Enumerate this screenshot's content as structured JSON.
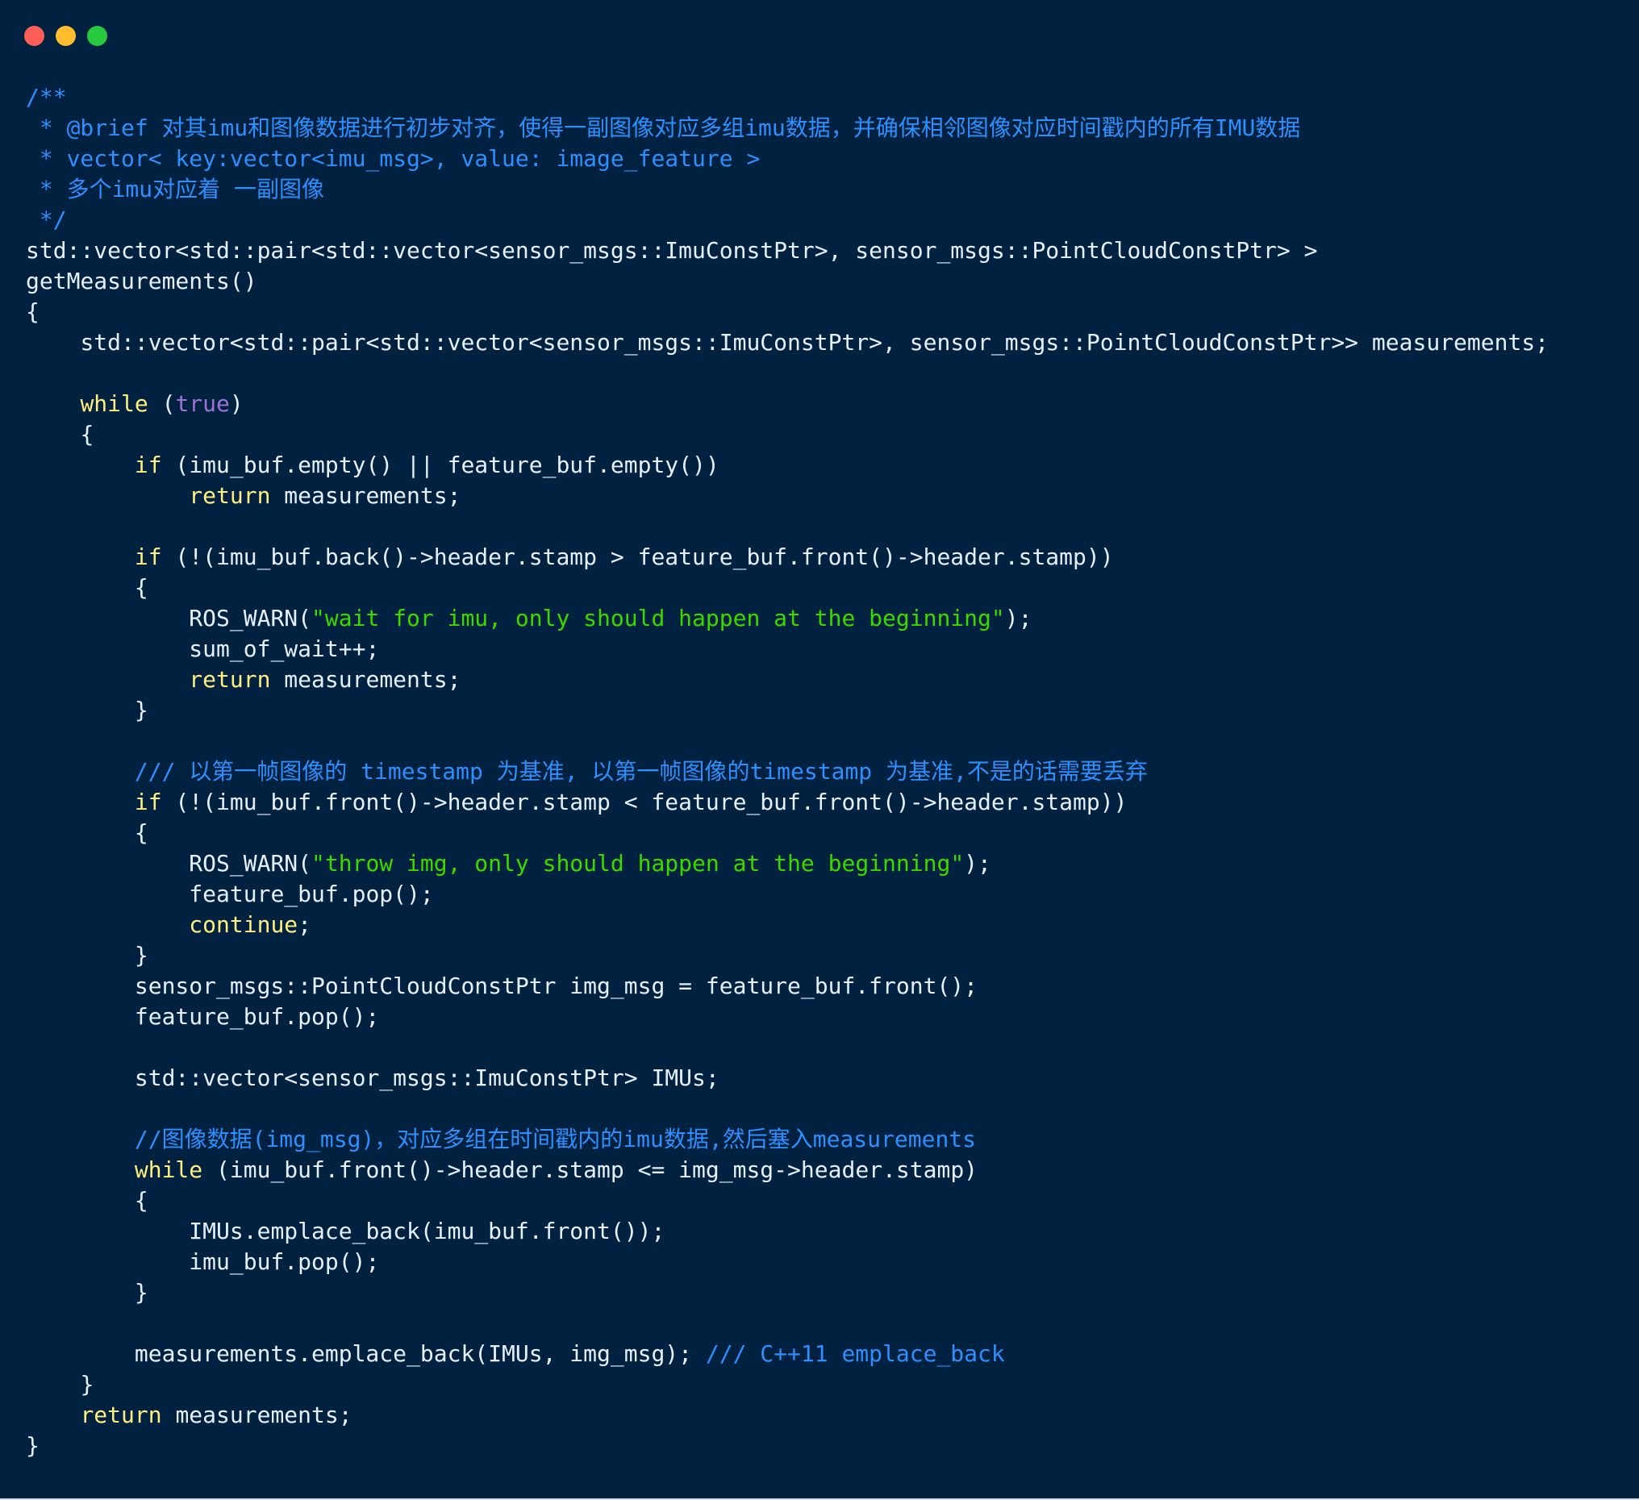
{
  "window": {
    "controls": [
      {
        "name": "close",
        "color": "#ff5f56"
      },
      {
        "name": "minimize",
        "color": "#ffbd2e"
      },
      {
        "name": "zoom",
        "color": "#27c93f"
      }
    ]
  },
  "code": {
    "lines": [
      {
        "indent": 0,
        "tokens": [
          {
            "t": "/**",
            "c": "c"
          }
        ]
      },
      {
        "indent": 0,
        "tokens": [
          {
            "t": " * @brief 对其imu和图像数据进行初步对齐，使得一副图像对应多组imu数据，并确保相邻图像对应时间戳内的所有IMU数据",
            "c": "c"
          }
        ]
      },
      {
        "indent": 0,
        "tokens": [
          {
            "t": " * vector< key:vector<imu_msg>, value: image_feature >",
            "c": "c"
          }
        ]
      },
      {
        "indent": 0,
        "tokens": [
          {
            "t": " * 多个imu对应着 一副图像",
            "c": "c"
          }
        ]
      },
      {
        "indent": 0,
        "tokens": [
          {
            "t": " */",
            "c": "c"
          }
        ]
      },
      {
        "indent": 0,
        "tokens": [
          {
            "t": "std::vector<std::pair<std::vector<sensor_msgs::ImuConstPtr>, sensor_msgs::PointCloudConstPtr> >",
            "c": "t"
          }
        ]
      },
      {
        "indent": 0,
        "tokens": [
          {
            "t": "getMeasurements()",
            "c": "t"
          }
        ]
      },
      {
        "indent": 0,
        "tokens": [
          {
            "t": "{",
            "c": "t"
          }
        ]
      },
      {
        "indent": 4,
        "tokens": [
          {
            "t": "std::vector<std::pair<std::vector<sensor_msgs::ImuConstPtr>, sensor_msgs::PointCloudConstPtr>> measurements;",
            "c": "t"
          }
        ]
      },
      {
        "indent": 0,
        "tokens": []
      },
      {
        "indent": 4,
        "tokens": [
          {
            "t": "while",
            "c": "k"
          },
          {
            "t": " (",
            "c": "t"
          },
          {
            "t": "true",
            "c": "b"
          },
          {
            "t": ")",
            "c": "t"
          }
        ]
      },
      {
        "indent": 4,
        "tokens": [
          {
            "t": "{",
            "c": "t"
          }
        ]
      },
      {
        "indent": 8,
        "tokens": [
          {
            "t": "if",
            "c": "k"
          },
          {
            "t": " (imu_buf.empty() || feature_buf.empty())",
            "c": "t"
          }
        ]
      },
      {
        "indent": 12,
        "tokens": [
          {
            "t": "return",
            "c": "k"
          },
          {
            "t": " measurements;",
            "c": "t"
          }
        ]
      },
      {
        "indent": 0,
        "tokens": []
      },
      {
        "indent": 8,
        "tokens": [
          {
            "t": "if",
            "c": "k"
          },
          {
            "t": " (!(imu_buf.back()->header.stamp > feature_buf.front()->header.stamp))",
            "c": "t"
          }
        ]
      },
      {
        "indent": 8,
        "tokens": [
          {
            "t": "{",
            "c": "t"
          }
        ]
      },
      {
        "indent": 12,
        "tokens": [
          {
            "t": "ROS_WARN(",
            "c": "t"
          },
          {
            "t": "\"wait for imu, only should happen at the beginning\"",
            "c": "s"
          },
          {
            "t": ");",
            "c": "t"
          }
        ]
      },
      {
        "indent": 12,
        "tokens": [
          {
            "t": "sum_of_wait++;",
            "c": "t"
          }
        ]
      },
      {
        "indent": 12,
        "tokens": [
          {
            "t": "return",
            "c": "k"
          },
          {
            "t": " measurements;",
            "c": "t"
          }
        ]
      },
      {
        "indent": 8,
        "tokens": [
          {
            "t": "}",
            "c": "t"
          }
        ]
      },
      {
        "indent": 0,
        "tokens": []
      },
      {
        "indent": 8,
        "tokens": [
          {
            "t": "/// 以第一帧图像的 timestamp 为基准, 以第一帧图像的timestamp 为基准,不是的话需要丢弃",
            "c": "c"
          }
        ]
      },
      {
        "indent": 8,
        "tokens": [
          {
            "t": "if",
            "c": "k"
          },
          {
            "t": " (!(imu_buf.front()->header.stamp < feature_buf.front()->header.stamp))",
            "c": "t"
          }
        ]
      },
      {
        "indent": 8,
        "tokens": [
          {
            "t": "{",
            "c": "t"
          }
        ]
      },
      {
        "indent": 12,
        "tokens": [
          {
            "t": "ROS_WARN(",
            "c": "t"
          },
          {
            "t": "\"throw img, only should happen at the beginning\"",
            "c": "s"
          },
          {
            "t": ");",
            "c": "t"
          }
        ]
      },
      {
        "indent": 12,
        "tokens": [
          {
            "t": "feature_buf.pop();",
            "c": "t"
          }
        ]
      },
      {
        "indent": 12,
        "tokens": [
          {
            "t": "continue",
            "c": "k"
          },
          {
            "t": ";",
            "c": "t"
          }
        ]
      },
      {
        "indent": 8,
        "tokens": [
          {
            "t": "}",
            "c": "t"
          }
        ]
      },
      {
        "indent": 8,
        "tokens": [
          {
            "t": "sensor_msgs::PointCloudConstPtr img_msg = feature_buf.front();",
            "c": "t"
          }
        ]
      },
      {
        "indent": 8,
        "tokens": [
          {
            "t": "feature_buf.pop();",
            "c": "t"
          }
        ]
      },
      {
        "indent": 0,
        "tokens": []
      },
      {
        "indent": 8,
        "tokens": [
          {
            "t": "std::vector<sensor_msgs::ImuConstPtr> IMUs;",
            "c": "t"
          }
        ]
      },
      {
        "indent": 0,
        "tokens": []
      },
      {
        "indent": 8,
        "tokens": [
          {
            "t": "//图像数据(img_msg)，对应多组在时间戳内的imu数据,然后塞入measurements",
            "c": "c"
          }
        ]
      },
      {
        "indent": 8,
        "tokens": [
          {
            "t": "while",
            "c": "k"
          },
          {
            "t": " (imu_buf.front()->header.stamp <= img_msg->header.stamp)",
            "c": "t"
          }
        ]
      },
      {
        "indent": 8,
        "tokens": [
          {
            "t": "{",
            "c": "t"
          }
        ]
      },
      {
        "indent": 12,
        "tokens": [
          {
            "t": "IMUs.emplace_back(imu_buf.front());",
            "c": "t"
          }
        ]
      },
      {
        "indent": 12,
        "tokens": [
          {
            "t": "imu_buf.pop();",
            "c": "t"
          }
        ]
      },
      {
        "indent": 8,
        "tokens": [
          {
            "t": "}",
            "c": "t"
          }
        ]
      },
      {
        "indent": 0,
        "tokens": []
      },
      {
        "indent": 8,
        "tokens": [
          {
            "t": "measurements.emplace_back(IMUs, img_msg); ",
            "c": "t"
          },
          {
            "t": "/// C++11 emplace_back",
            "c": "c"
          }
        ]
      },
      {
        "indent": 4,
        "tokens": [
          {
            "t": "}",
            "c": "t"
          }
        ]
      },
      {
        "indent": 4,
        "tokens": [
          {
            "t": "return",
            "c": "k"
          },
          {
            "t": " measurements;",
            "c": "t"
          }
        ]
      },
      {
        "indent": 0,
        "tokens": [
          {
            "t": "}",
            "c": "t"
          }
        ]
      }
    ]
  }
}
